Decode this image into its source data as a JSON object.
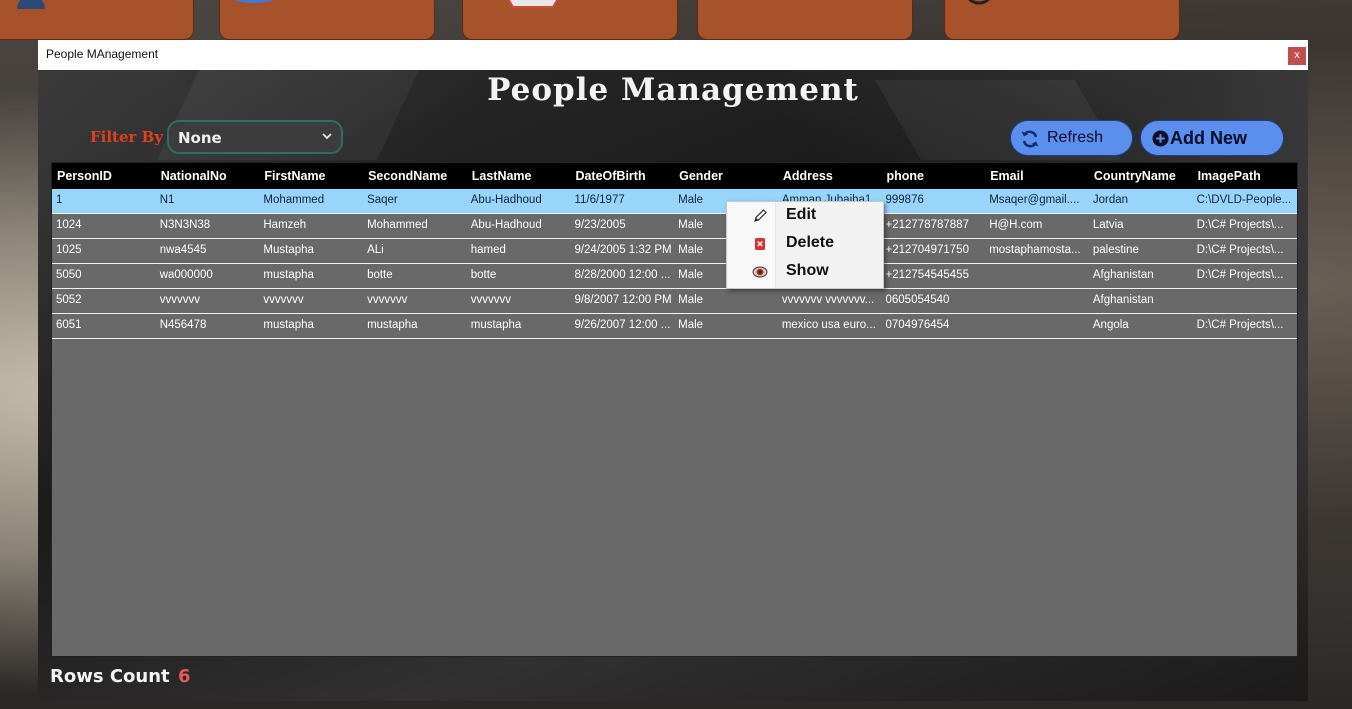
{
  "window": {
    "title": "People MAnagement",
    "close_label": "x"
  },
  "page_title": "People Management",
  "filter": {
    "label": "Filter By",
    "selected": "None"
  },
  "buttons": {
    "refresh": "Refresh",
    "add_new": "Add New"
  },
  "columns": [
    "PersonID",
    "NationalNo",
    "FirstName",
    "SecondName",
    "LastName",
    "DateOfBirth",
    "Gender",
    "Address",
    "phone",
    "Email",
    "CountryName",
    "ImagePath"
  ],
  "rows": [
    [
      "1",
      "N1",
      "Mohammed",
      "Saqer",
      "Abu-Hadhoud",
      "11/6/1977",
      "Male",
      "Amman Jubaiha1",
      "999876",
      "Msaqer@gmail....",
      "Jordan",
      "C:\\DVLD-People..."
    ],
    [
      "1024",
      "N3N3N38",
      "Hamzeh",
      "Mohammed",
      "Abu-Hadhoud",
      "9/23/2005",
      "Male",
      "",
      "+212778787887",
      "H@H.com",
      "Latvia",
      "D:\\C# Projects\\..."
    ],
    [
      "1025",
      "nwa4545",
      "Mustapha",
      "ALi",
      "hamed",
      "9/24/2005 1:32 PM",
      "Male",
      "",
      "+212704971750",
      "mostaphamosta...",
      "palestine",
      "D:\\C# Projects\\..."
    ],
    [
      "5050",
      "wa000000",
      "mustapha",
      "botte",
      "botte",
      "8/28/2000 12:00 ...",
      "Male",
      "",
      "+212754545455",
      "",
      "Afghanistan",
      "D:\\C# Projects\\..."
    ],
    [
      "5052",
      "vvvvvvv",
      "vvvvvvv",
      "vvvvvvv",
      "vvvvvvv",
      "9/8/2007 12:00 PM",
      "Male",
      "vvvvvvv vvvvvvv...",
      "0605054540",
      "",
      "Afghanistan",
      ""
    ],
    [
      "6051",
      "N456478",
      "mustapha",
      "mustapha",
      "mustapha",
      "9/26/2007 12:00 ...",
      "Male",
      "mexico usa euro...",
      "0704976454",
      "",
      "Angola",
      "D:\\C# Projects\\..."
    ]
  ],
  "selected_row": 0,
  "context_menu": [
    {
      "label": "Edit",
      "icon": "pencil-icon"
    },
    {
      "label": "Delete",
      "icon": "delete-icon"
    },
    {
      "label": "Show",
      "icon": "eye-icon"
    }
  ],
  "footer": {
    "rows_count_label": "Rows Count",
    "rows_count_value": "6"
  },
  "colors": {
    "accent_button": "#5a8fee",
    "filter_label": "#e0401c",
    "selected_row": "#99d4fb",
    "rows_value": "#e55a5a"
  }
}
